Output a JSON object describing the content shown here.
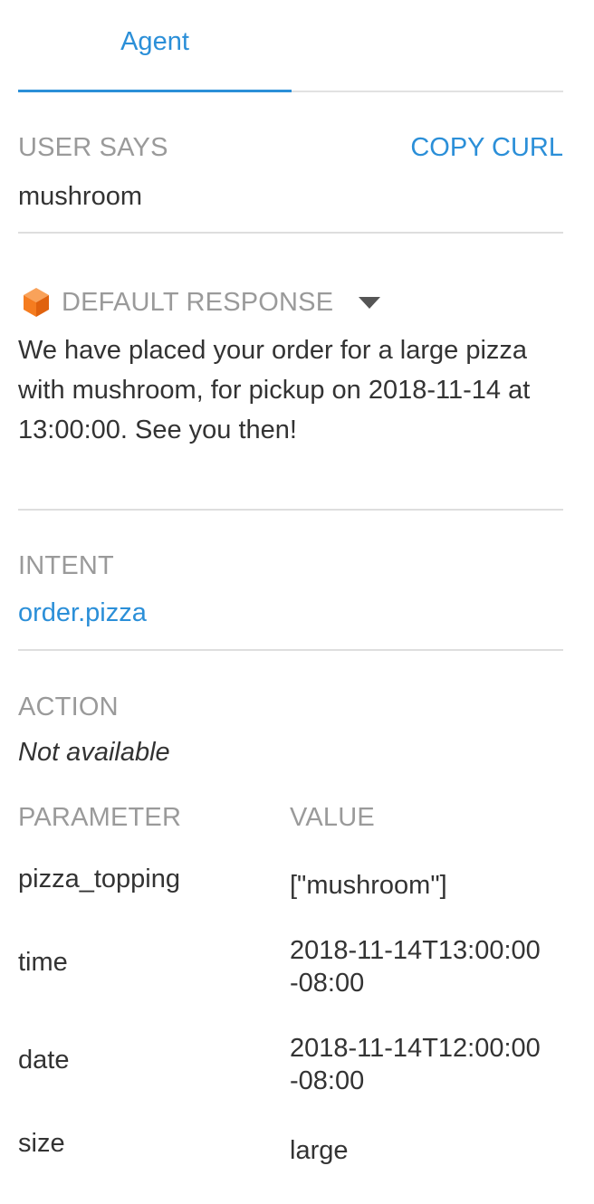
{
  "tabs": {
    "agent_label": "Agent"
  },
  "user_says": {
    "heading": "USER SAYS",
    "copy_curl_label": "COPY CURL",
    "text": "mushroom"
  },
  "response": {
    "heading": "DEFAULT RESPONSE",
    "icon": "orange-cube-icon",
    "text": "We have placed your order for a large pizza with mushroom, for pickup on 2018-11-14 at 13:00:00. See you then!"
  },
  "intent": {
    "heading": "INTENT",
    "value": "order.pizza"
  },
  "action": {
    "heading": "ACTION",
    "value": "Not available"
  },
  "parameters": {
    "name_header": "PARAMETER",
    "value_header": "VALUE",
    "rows": [
      {
        "name": "pizza_topping",
        "value": "[\"mushroom\"]"
      },
      {
        "name": "time",
        "value": "2018-11-14T13:00:00 -08:00"
      },
      {
        "name": "date",
        "value": "2018-11-14T12:00:00 -08:00"
      },
      {
        "name": "size",
        "value": "large"
      }
    ]
  },
  "colors": {
    "accent": "#2b8fd8",
    "muted": "#9a9a9a",
    "icon_orange": "#f57c1f"
  }
}
